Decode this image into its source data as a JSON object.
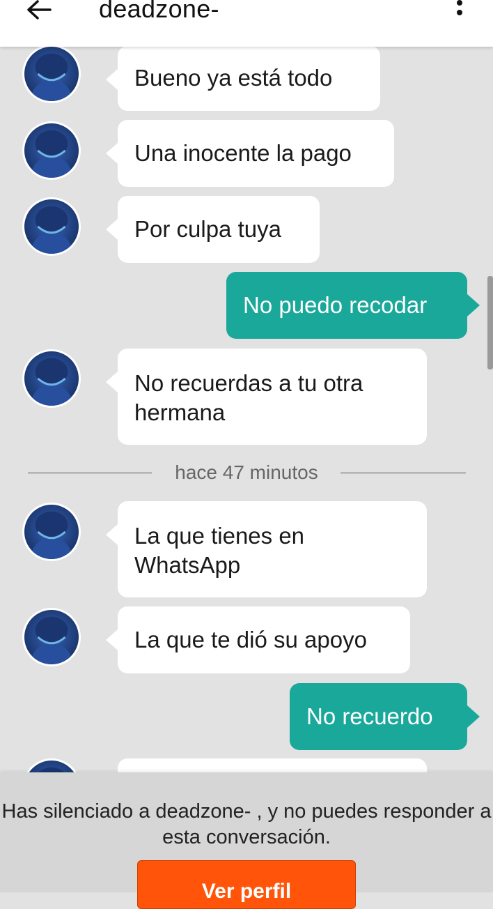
{
  "header": {
    "title": "deadzone-",
    "back_icon": "arrow-left-icon",
    "menu_icon": "more-vertical-icon"
  },
  "messages": [
    {
      "side": "in",
      "text": "Bueno  ya está todo"
    },
    {
      "side": "in",
      "text": "Una inocente la pago"
    },
    {
      "side": "in",
      "text": "Por culpa tuya"
    },
    {
      "side": "out",
      "text": "No puedo recodar"
    },
    {
      "side": "in",
      "text": "No recuerdas a tu otra hermana"
    },
    {
      "side": "in",
      "text": " La que tienes en WhatsApp"
    },
    {
      "side": "in",
      "text": "La que te dió su apoyo"
    },
    {
      "side": "out",
      "text": "No recuerdo"
    }
  ],
  "divider": {
    "text": "hace 47 minutos"
  },
  "footer": {
    "notice": "Has silenciado a deadzone- , y no puedes responder a esta conversación.",
    "profile_button": "Ver perfil"
  },
  "colors": {
    "background": "#e2e2e2",
    "outgoing_bubble": "#19a89a",
    "incoming_bubble": "#ffffff",
    "button": "#ff5409",
    "avatar": "#20407e"
  }
}
